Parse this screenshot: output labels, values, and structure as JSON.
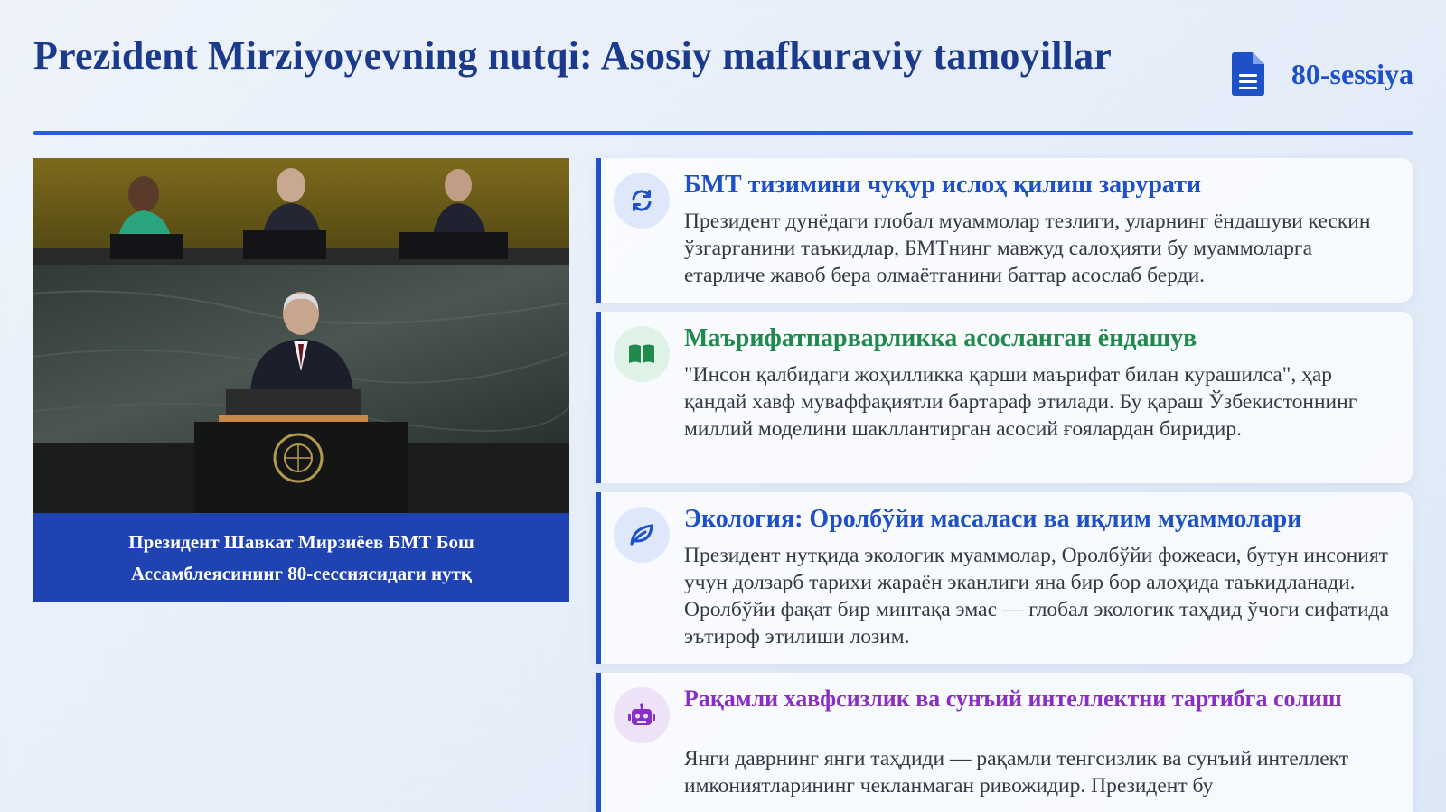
{
  "header": {
    "title": "Prezident Mirziyoyevning nutqi: Asosiy mafkuraviy tamoyillar",
    "session_label": "80-sessiya",
    "session_icon": "document-icon"
  },
  "photo": {
    "caption": "Президент Шавкат Мирзиёев БМТ Бош Ассамблеясининг 80-сессиясидаги нутқ"
  },
  "cards": [
    {
      "icon": "refresh-icon",
      "accent": "#1e50c8",
      "title": "БМТ тизимини чуқур ислоҳ қилиш зарурати",
      "body": "Президент дунёдаги глобал муаммолар тезлиги, уларнинг ёндашуви кескин ўзгарганини таъкидлар, БМТнинг мавжуд салоҳияти бу муаммоларга етарличе жавоб бера олмаётганини баттар асослаб берди."
    },
    {
      "icon": "open-book-icon",
      "accent": "#1f8a4c",
      "title": "Маърифатпарварликка асосланган ёндашув",
      "body": "\"Инсон қалбидаги жоҳилликка қарши маърифат билан курашилса\", ҳар қандай хавф муваффақиятли бартараф этилади. Бу қараш Ўзбекистоннинг миллий моделини шакллантирган асосий ғоялардан биридир."
    },
    {
      "icon": "leaf-icon",
      "accent": "#1e50c8",
      "title": "Экология: Оролбўйи масаласи ва иқлим муаммолари",
      "body": "Президент нутқида экологик муаммолар, Оролбўйи фожеаси, бутун инсоният учун долзарб тарихи жараён эканлиги яна бир бор алоҳида таъкидланади. Оролбўйи фақат бир минтақа эмас — глобал экологик таҳдид ўчоғи сифатида эътироф этилиши лозим."
    },
    {
      "icon": "robot-icon",
      "accent": "#8a2ec8",
      "title": "Рақамли хавфсизлик ва сунъий интеллектни тартибга солиш",
      "body": "Янги даврнинг янги таҳдиди — рақамли тенгсизлик ва сунъий интеллект имкониятларининг чекланмаган ривожидир. Президент бу"
    }
  ]
}
